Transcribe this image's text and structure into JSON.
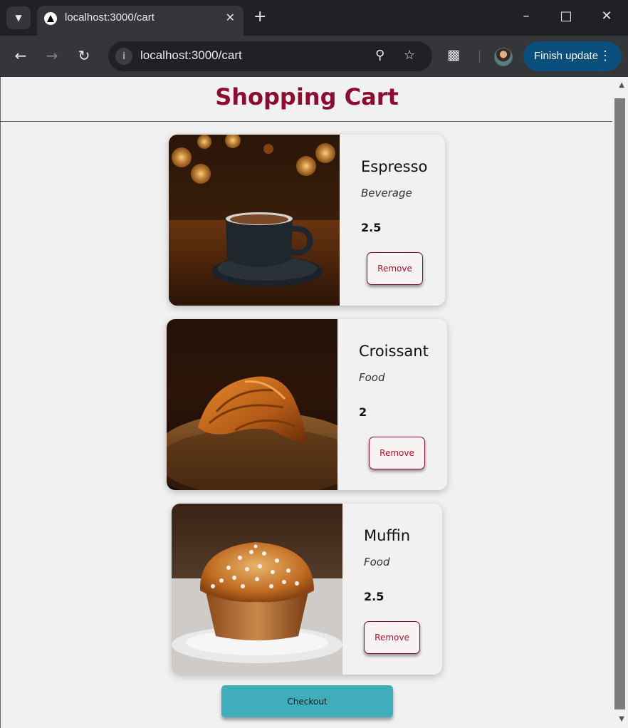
{
  "browser": {
    "tab_title": "localhost:3000/cart",
    "url": "localhost:3000/cart",
    "update_label": "Finish update"
  },
  "page": {
    "title": "Shopping Cart",
    "checkout_label": "Checkout"
  },
  "cart": {
    "items": [
      {
        "name": "Espresso",
        "category": "Beverage",
        "price": "2.5",
        "remove_label": "Remove",
        "image": "espresso-photo"
      },
      {
        "name": "Croissant",
        "category": "Food",
        "price": "2",
        "remove_label": "Remove",
        "image": "croissant-photo"
      },
      {
        "name": "Muffin",
        "category": "Food",
        "price": "2.5",
        "remove_label": "Remove",
        "image": "muffin-photo"
      }
    ]
  },
  "colors": {
    "title": "#8b0e32",
    "remove_text": "#b0102e",
    "checkout_bg": "#3fadba",
    "page_bg": "#f2f1f1",
    "update_button": "#0b4f7c"
  },
  "icons": {
    "tab_search": "chevron-down-icon",
    "favicon": "triangle-logo-icon",
    "back": "arrow-left-icon",
    "forward": "arrow-right-icon",
    "reload": "reload-icon",
    "site_info": "info-icon",
    "zoom": "zoom-out-icon",
    "bookmark": "star-icon",
    "extensions": "puzzle-icon",
    "menu": "kebab-menu-icon"
  }
}
